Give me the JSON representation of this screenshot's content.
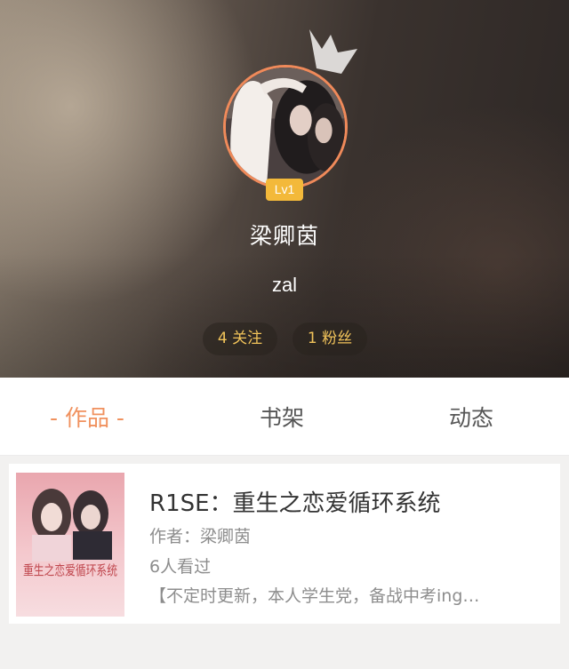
{
  "profile": {
    "level": "Lv1",
    "name": "梁卿茵",
    "signature": "zal",
    "following": "4 关注",
    "fans": "1 粉丝"
  },
  "tabs": [
    {
      "label": "- 作品 -",
      "active": true
    },
    {
      "label": "书架",
      "active": false
    },
    {
      "label": "动态",
      "active": false
    }
  ],
  "works": [
    {
      "cover_text": "重生之恋爱循环系统",
      "title": "R1SE：重生之恋爱循环系统",
      "author": "作者：梁卿茵",
      "views": "6人看过",
      "description": "【不定时更新，本人学生党，备战中考ing…"
    }
  ],
  "colors": {
    "accent": "#f0915e",
    "level_badge": "#f3b93a",
    "stat_text": "#f1c35a"
  },
  "icons": [
    "crown-icon"
  ]
}
